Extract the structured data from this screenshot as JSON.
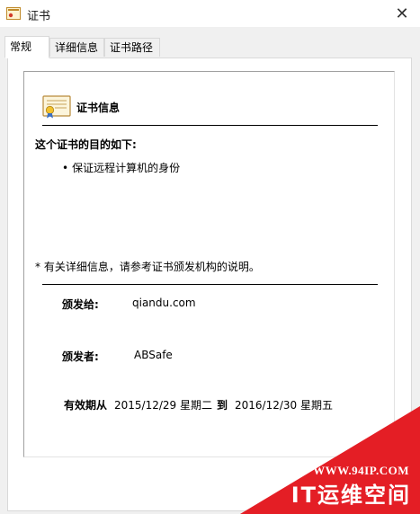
{
  "window": {
    "title": "证书",
    "icon": "certificate-icon",
    "close_glyph": "✕"
  },
  "tabs": [
    {
      "label": "常规",
      "active": true
    },
    {
      "label": "详细信息",
      "active": false
    },
    {
      "label": "证书路径",
      "active": false
    }
  ],
  "general": {
    "heading": "证书信息",
    "purpose_title": "这个证书的目的如下:",
    "purposes": [
      "保证远程计算机的身份"
    ],
    "note": "* 有关详细信息，请参考证书颁发机构的说明。",
    "issued_to_label": "颁发给:",
    "issued_to_value": "qiandu.com",
    "issued_by_label": "颁发者:",
    "issued_by_value": "ABSafe",
    "validity_label": "有效期从",
    "valid_from": "2015/12/29 星期二",
    "to_label": "到",
    "valid_to": "2016/12/30 星期五"
  },
  "watermark": {
    "url": "WWW.94IP.COM",
    "brand": "IT运维空间",
    "color": "#e41e25"
  }
}
